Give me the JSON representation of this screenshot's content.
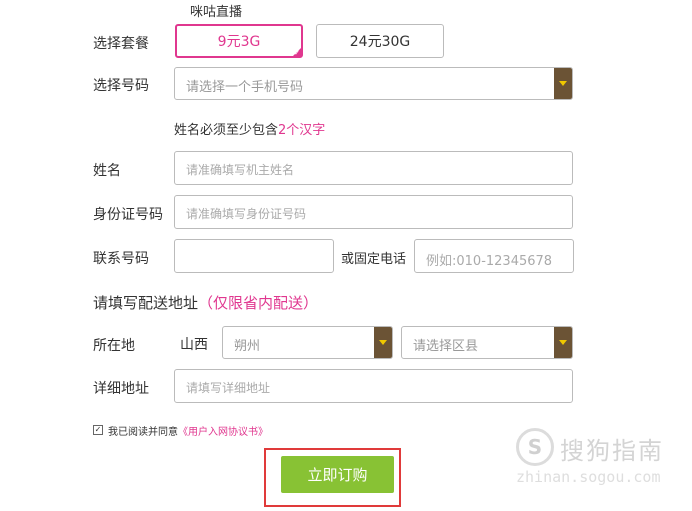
{
  "header_text": "咪咕直播",
  "rows": {
    "plan_label": "选择套餐",
    "number_label": "选择号码",
    "name_label": "姓名",
    "id_label": "身份证号码",
    "phone_label": "联系号码",
    "landline_label": "或固定电话",
    "region_label": "所在地",
    "address_label": "详细地址"
  },
  "plans": [
    {
      "label": "9元3G",
      "selected": true
    },
    {
      "label": "24元30G",
      "selected": false
    }
  ],
  "number_select": {
    "placeholder": "请选择一个手机号码"
  },
  "notice": {
    "prefix": "姓名必须至少包含",
    "highlight": "2个汉字"
  },
  "fields": {
    "name_placeholder": "请准确填写机主姓名",
    "id_placeholder": "请准确填写身份证号码",
    "phone_value": "",
    "landline_placeholder": "例如:010-12345678",
    "address_placeholder": "请填写详细地址"
  },
  "section": {
    "title": "请填写配送地址",
    "note": "（仅限省内配送）"
  },
  "region": {
    "province": "山西",
    "city": "朔州",
    "district_placeholder": "请选择区县"
  },
  "agreement": {
    "prefix": "我已阅读并同意",
    "link": "《用户入网协议书》",
    "checked": true
  },
  "submit_label": "立即订购",
  "watermark": {
    "logo": "S",
    "text": "搜狗指南",
    "sub": "zhinan.sogou.com"
  },
  "colors": {
    "accent": "#e0378f",
    "submit": "#88c234",
    "dropdown": "#6b5335",
    "highlight_border": "#e03a3a"
  }
}
